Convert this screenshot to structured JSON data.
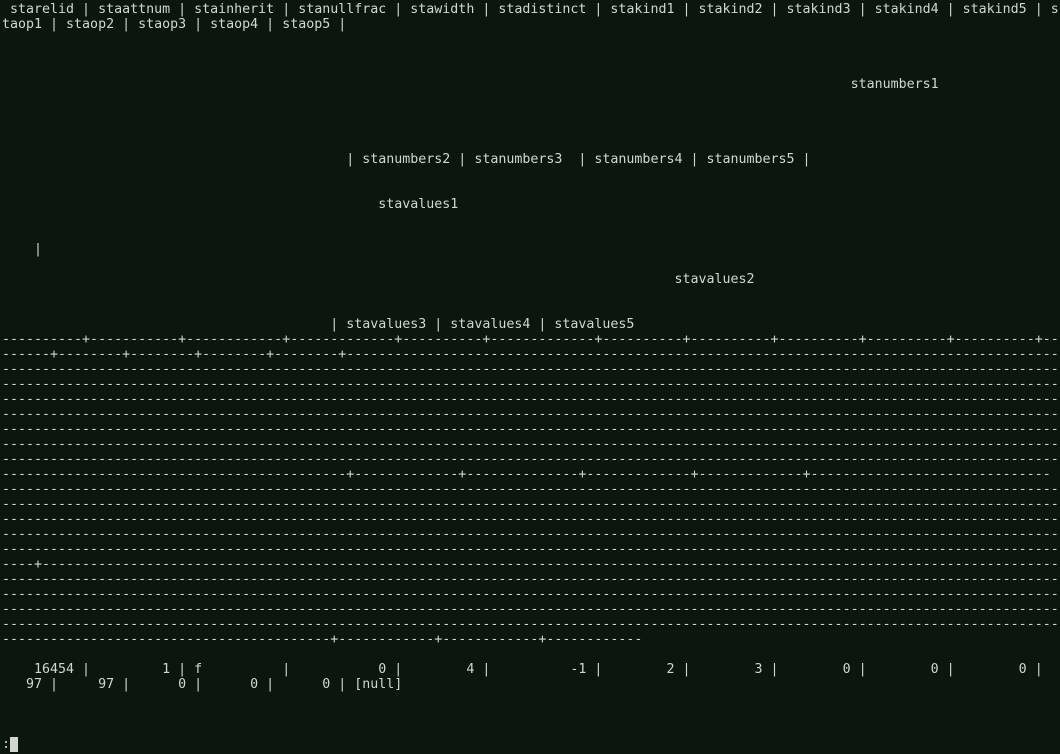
{
  "terminal": {
    "lines": [
      " starelid | staattnum | stainherit | stanullfrac | stawidth | stadistinct | stakind1 | stakind2 | stakind3 | stakind4 | stakind5 | s",
      "taop1 | staop2 | staop3 | staop4 | staop5 |",
      "                                                                                                          stanumbers1",
      "                                           | stanumbers2 | stanumbers3  | stanumbers4 | stanumbers5 |",
      "                                               stavalues1",
      "    |",
      "                                                                                    stavalues2",
      "                                         | stavalues3 | stavalues4 | stavalues5",
      "----------+-----------+------------+-------------+----------+-------------+----------+----------+----------+----------+----------+--",
      "------+--------+--------+--------+--------+--------------------------------------------------------------------------------------------",
      "------------------------------------------------------------------------------------------------------------------------------------",
      "------------------------------------------------------------------------------------------------------------------------------------",
      "------------------------------------------------------------------------------------------------------------------------------------",
      "------------------------------------------------------------------------------------------------------------------------------------",
      "------------------------------------------------------------------------------------------------------------------------------------",
      "------------------------------------------------------------------------------------------------------------------------------------",
      "------------------------------------------------------------------------------------------------------------------------------------",
      "-------------------------------------------+-------------+--------------+-------------+-------------+------------------------------",
      "------------------------------------------------------------------------------------------------------------------------------------",
      "------------------------------------------------------------------------------------------------------------------------------------",
      "------------------------------------------------------------------------------------------------------------------------------------",
      "------------------------------------------------------------------------------------------------------------------------------------",
      "------------------------------------------------------------------------------------------------------------------------------------",
      "----+-------------------------------------------------------------------------------------------------------------------------------",
      "------------------------------------------------------------------------------------------------------------------------------------",
      "------------------------------------------------------------------------------------------------------------------------------------",
      "------------------------------------------------------------------------------------------------------------------------------------",
      "------------------------------------------------------------------------------------------------------------------------------------",
      "-----------------------------------------+------------+------------+------------",
      "    16454 |         1 | f          |           0 |        4 |          -1 |        2 |        3 |        0 |        0 |        0 |",
      "   97 |     97 |      0 |      0 |      0 | [null]"
    ],
    "prompt": ":"
  }
}
